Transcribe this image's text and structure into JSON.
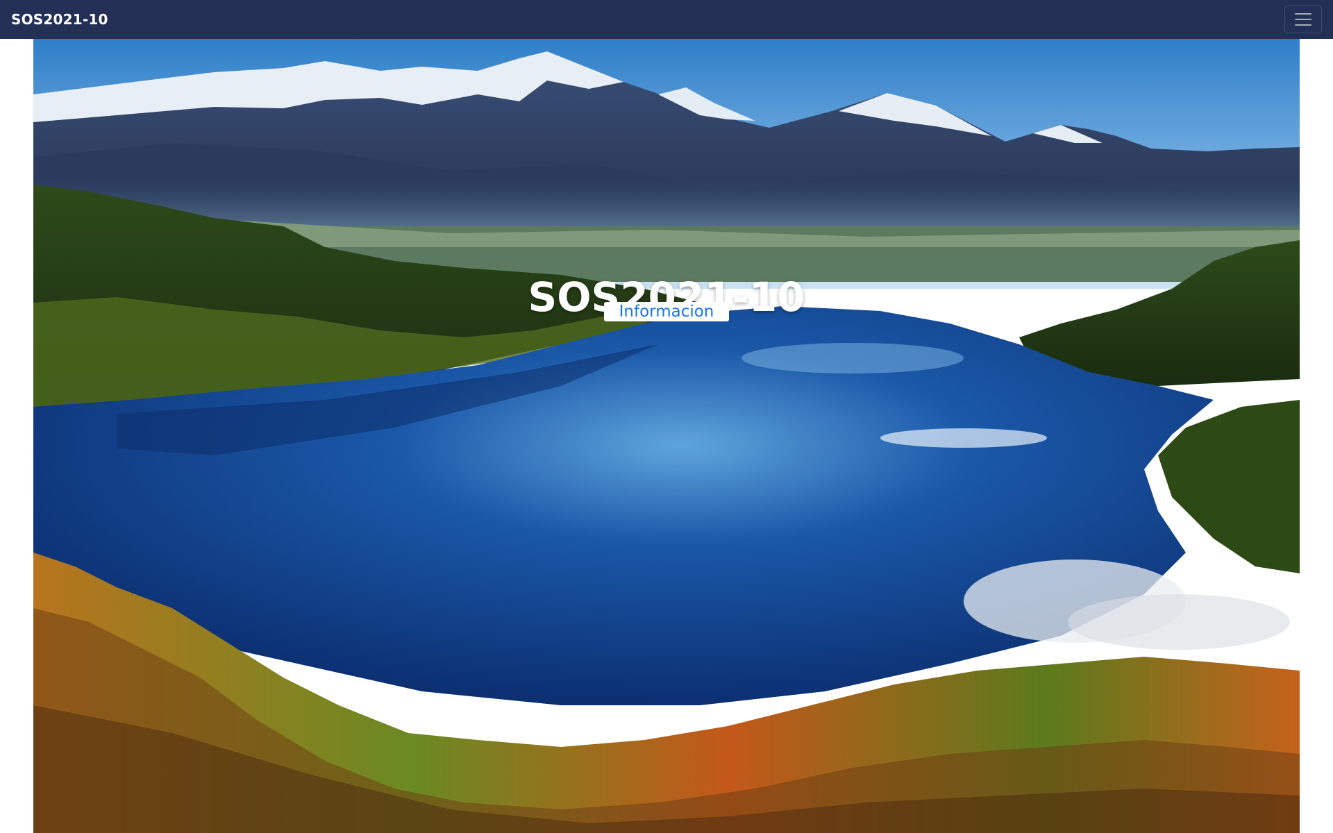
{
  "navbar": {
    "brand": "SOS2021-10",
    "toggler_icon": "hamburger-menu-icon",
    "background": "#232f55"
  },
  "hero": {
    "image_description": "mountain-lake-landscape",
    "title": "SOS2021-10",
    "button_label": "Informacion",
    "button_color": "#1a73e8"
  }
}
